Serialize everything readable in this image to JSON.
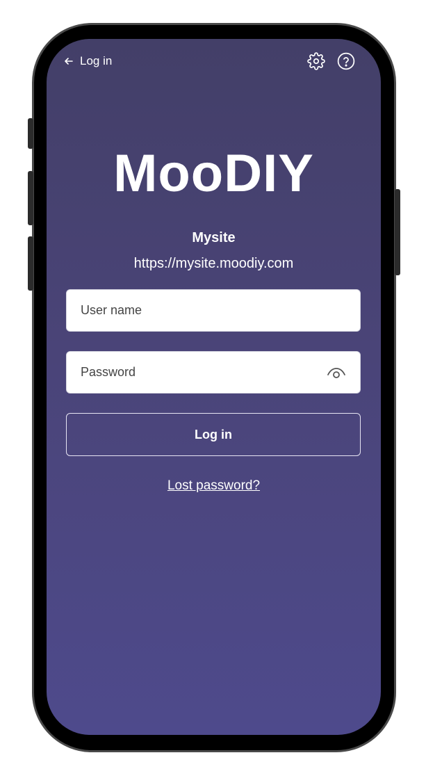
{
  "topbar": {
    "back_label": "Log in",
    "settings_icon": "gear-icon",
    "help_icon": "question-circle-icon"
  },
  "app": {
    "logo": "MooDIY",
    "site_name": "Mysite",
    "site_url": "https://mysite.moodiy.com"
  },
  "form": {
    "username_placeholder": "User name",
    "password_placeholder": "Password",
    "password_toggle_icon": "eye-icon",
    "submit_label": "Log in",
    "lost_password_label": "Lost password?"
  },
  "colors": {
    "background_top": "#433f68",
    "background_bottom": "#4e4a8c",
    "text": "#ffffff"
  }
}
